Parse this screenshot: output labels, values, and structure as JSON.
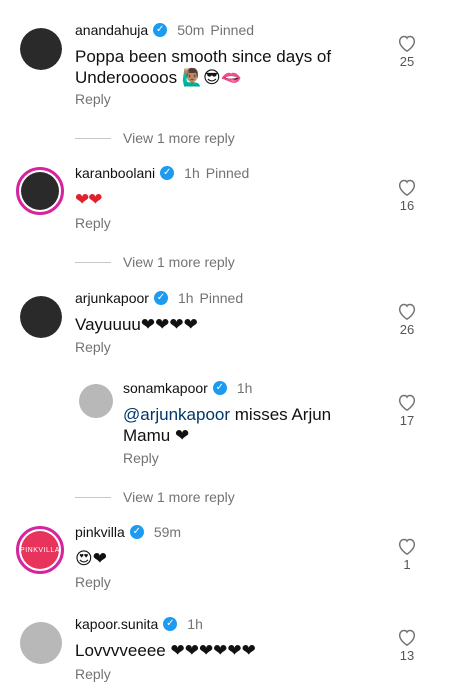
{
  "comments": [
    {
      "user": "anandahuja",
      "verified": true,
      "time": "50m",
      "pinned": "Pinned",
      "text": "Poppa been smooth since days of Underooooos 🙋🏽‍♂️😎🫦",
      "reply": "Reply",
      "likes": "25",
      "avatar": "dark"
    },
    {
      "more": "View 1 more reply"
    },
    {
      "user": "karanboolani",
      "verified": true,
      "time": "1h",
      "pinned": "Pinned",
      "text": "❤❤",
      "reply": "Reply",
      "likes": "16",
      "avatar": "ring-dark"
    },
    {
      "more": "View 1 more reply"
    },
    {
      "user": "arjunkapoor",
      "verified": true,
      "time": "1h",
      "pinned": "Pinned",
      "text": "Vayuuuu❤❤❤❤",
      "reply": "Reply",
      "likes": "26",
      "avatar": "dark"
    },
    {
      "user": "sonamkapoor",
      "verified": true,
      "time": "1h",
      "mention": "@arjunkapoor",
      "text": " misses Arjun Mamu ❤",
      "reply": "Reply",
      "likes": "17",
      "avatar": "light",
      "nested": true
    },
    {
      "more": "View 1 more reply"
    },
    {
      "user": "pinkvilla",
      "verified": true,
      "time": "59m",
      "text": "😍❤",
      "reply": "Reply",
      "likes": "1",
      "avatar": "ring-pink",
      "avatar_text": "PINKVILLA"
    },
    {
      "user": "kapoor.sunita",
      "verified": true,
      "time": "1h",
      "text": "Lovvvveeee ❤❤❤❤❤❤",
      "reply": "Reply",
      "likes": "13",
      "avatar": "light"
    }
  ],
  "icons": {
    "like": "heart-outline-icon",
    "verified": "verified-badge-icon"
  },
  "colors": {
    "verified": "#1d9bf0",
    "heart": "#e0212d",
    "secondary_text": "#737373",
    "mention": "#00376b"
  }
}
